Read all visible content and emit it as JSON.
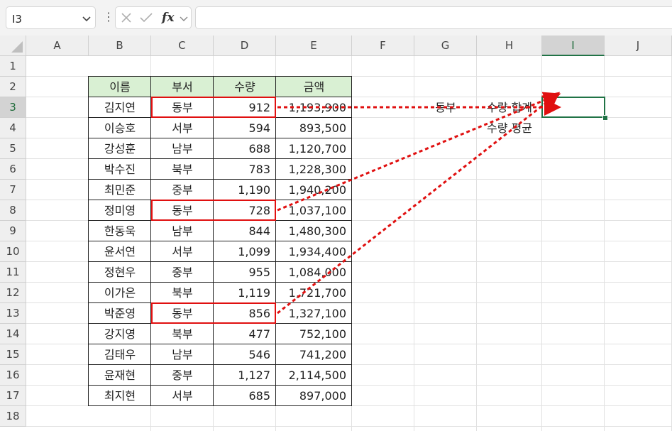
{
  "namebox": {
    "value": "I3"
  },
  "formula": {
    "value": ""
  },
  "columns": [
    "A",
    "B",
    "C",
    "D",
    "E",
    "F",
    "G",
    "H",
    "I",
    "J"
  ],
  "rows": [
    "1",
    "2",
    "3",
    "4",
    "5",
    "6",
    "7",
    "8",
    "9",
    "10",
    "11",
    "12",
    "13",
    "14",
    "15",
    "16",
    "17",
    "18"
  ],
  "selected_column": "I",
  "selected_row": "3",
  "table": {
    "headers": [
      "이름",
      "부서",
      "수량",
      "금액"
    ],
    "rows": [
      [
        "김지연",
        "동부",
        "912",
        "1,193,900"
      ],
      [
        "이승호",
        "서부",
        "594",
        "893,500"
      ],
      [
        "강성훈",
        "남부",
        "688",
        "1,120,700"
      ],
      [
        "박수진",
        "북부",
        "783",
        "1,228,300"
      ],
      [
        "최민준",
        "중부",
        "1,190",
        "1,940,200"
      ],
      [
        "정미영",
        "동부",
        "728",
        "1,037,100"
      ],
      [
        "한동욱",
        "남부",
        "844",
        "1,480,300"
      ],
      [
        "윤서연",
        "서부",
        "1,099",
        "1,934,400"
      ],
      [
        "정현우",
        "중부",
        "955",
        "1,084,000"
      ],
      [
        "이가은",
        "북부",
        "1,119",
        "1,721,700"
      ],
      [
        "박준영",
        "동부",
        "856",
        "1,327,100"
      ],
      [
        "강지영",
        "북부",
        "477",
        "752,100"
      ],
      [
        "김태우",
        "남부",
        "546",
        "741,200"
      ],
      [
        "윤재현",
        "중부",
        "1,127",
        "2,114,500"
      ],
      [
        "최지현",
        "서부",
        "685",
        "897,000"
      ]
    ]
  },
  "criteria": {
    "g3": "동부",
    "h3": "수량 합계",
    "h4": "수량 평균"
  },
  "colors": {
    "header_fill": "#d9f0d3",
    "highlight": "#e01010",
    "active": "#217346"
  }
}
